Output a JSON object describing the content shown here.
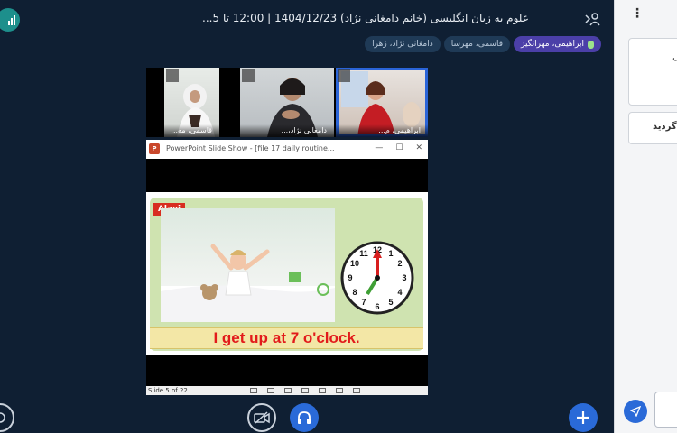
{
  "header": {
    "title": "علوم به زبان انگلیسی (خانم دامغانی نژاد) 1404/12/23 | 12:00 تا 5...",
    "talking_indicators": [
      {
        "name": "ابراهیمی، مهرانگیز",
        "active": true
      },
      {
        "name": "قاسمی، مهرسا",
        "active": false
      },
      {
        "name": "دامغانی نژاد، زهرا",
        "active": false
      }
    ]
  },
  "webcams": [
    {
      "name": "قاسمی، مه...",
      "selected": false
    },
    {
      "name": "دامغانی نژاد،...",
      "selected": false
    },
    {
      "name": "ابراهیمی، م...",
      "selected": true
    }
  ],
  "presentation": {
    "window_title": "PowerPoint Slide Show - [file 17 daily routine...",
    "app_logo_text": "P",
    "slide": {
      "tag": "Alavi",
      "sentence_part1": "I get up",
      "sentence_part2": "at 7 o'clock."
    },
    "status": {
      "slide_number": "Slide 5 of 22"
    }
  },
  "sidebar": {
    "menu_icon": "more-vertical-icon",
    "card1_fragment": "ل",
    "card2_fragment": "گردید"
  },
  "icons": {
    "stats": "bar-chart-icon",
    "user_toggle": "user-list-icon",
    "actions": "plus-icon",
    "video": "video-off-icon",
    "audio": "headphones-icon",
    "leave": "leave-icon",
    "send": "send-icon"
  },
  "colors": {
    "background": "#0f1f33",
    "accent": "#2a6ad8",
    "talker_active": "#4b3fa8",
    "stats": "#1d8f8c"
  }
}
